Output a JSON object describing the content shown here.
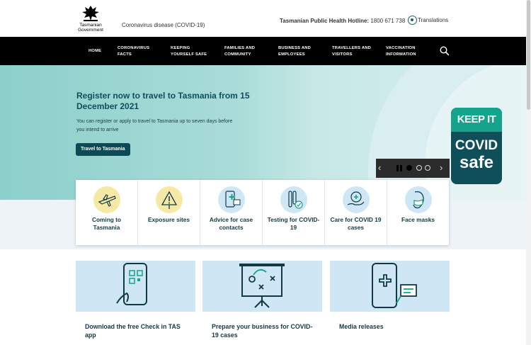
{
  "header": {
    "logo_text": "Tasmanian Government",
    "covid_link": "Coronavirus disease (COVID-19)",
    "hotline_label": "Tasmanian Public Health Hotline:",
    "hotline_number": "1800 671 738",
    "translations": "Translations"
  },
  "nav": {
    "items": [
      {
        "label": "HOME"
      },
      {
        "label": "CORONAVIRUS FACTS"
      },
      {
        "label": "KEEPING YOURSELF SAFE"
      },
      {
        "label": "FAMILIES AND COMMUNITY"
      },
      {
        "label": "BUSINESS AND EMPLOYEES"
      },
      {
        "label": "TRAVELLERS AND VISITORS"
      },
      {
        "label": "VACCINATION INFORMATION"
      }
    ],
    "search_icon": "search-icon"
  },
  "hero": {
    "title": "Register now to travel to Tasmania from 15 December 2021",
    "description": "You can register or apply to travel to Tasmania up to seven days before you intend to arrive",
    "button": "Travel to Tasmania",
    "badge_line1": "KEEP IT",
    "badge_line2": "COVID",
    "badge_line3": "safe",
    "carousel": {
      "slides": 4,
      "active": 1
    }
  },
  "quick_links": [
    {
      "label": "Coming to Tasmania",
      "icon": "plane-icon",
      "color": "#f6e9a6"
    },
    {
      "label": "Exposure sites",
      "icon": "warning-icon",
      "color": "#f6e9a6"
    },
    {
      "label": "Advice for case contacts",
      "icon": "phone-cross-icon",
      "color": "#cfe7f5"
    },
    {
      "label": "Testing for COVID-19",
      "icon": "test-tube-icon",
      "color": "#cfe7f5"
    },
    {
      "label": "Care for COVID 19 cases",
      "icon": "care-hand-icon",
      "color": "#cfe7f5"
    },
    {
      "label": "Face masks",
      "icon": "face-mask-icon",
      "color": "#cfe7f5"
    }
  ],
  "cards": [
    {
      "title": "Download the free Check in TAS app",
      "icon": "qr-phone-icon"
    },
    {
      "title": "Prepare your business for COVID-19 cases",
      "icon": "strategy-board-icon"
    },
    {
      "title": "Media releases",
      "icon": "media-phone-icon"
    }
  ],
  "colors": {
    "nav_bg": "#000000",
    "teal_dark": "#0d4a55",
    "hero_bg": "#a9dcd8",
    "accent_green": "#14a38b"
  }
}
